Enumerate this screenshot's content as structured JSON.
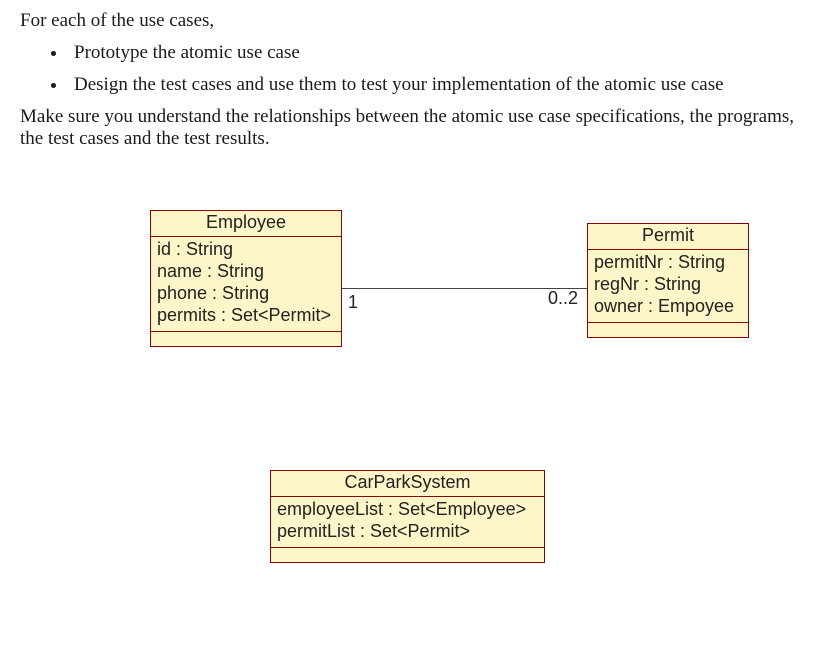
{
  "intro": {
    "lead": "For each of the use cases,",
    "bullets": [
      "Prototype the atomic use case",
      "Design the test cases and use them to test your implementation of the atomic use case"
    ],
    "followup": "Make sure you understand the relationships between the atomic use case specifications, the programs, the test cases and the test results."
  },
  "classes": {
    "employee": {
      "name": "Employee",
      "attrs": [
        "id : String",
        "name : String",
        "phone : String",
        "permits : Set<Permit>"
      ]
    },
    "permit": {
      "name": "Permit",
      "attrs": [
        "permitNr : String",
        "regNr : String",
        "owner : Empoyee"
      ]
    },
    "system": {
      "name": "CarParkSystem",
      "attrs": [
        "employeeList : Set<Employee>",
        "permitList : Set<Permit>"
      ]
    }
  },
  "assoc": {
    "left_mult": "1",
    "right_mult": "0..2"
  }
}
